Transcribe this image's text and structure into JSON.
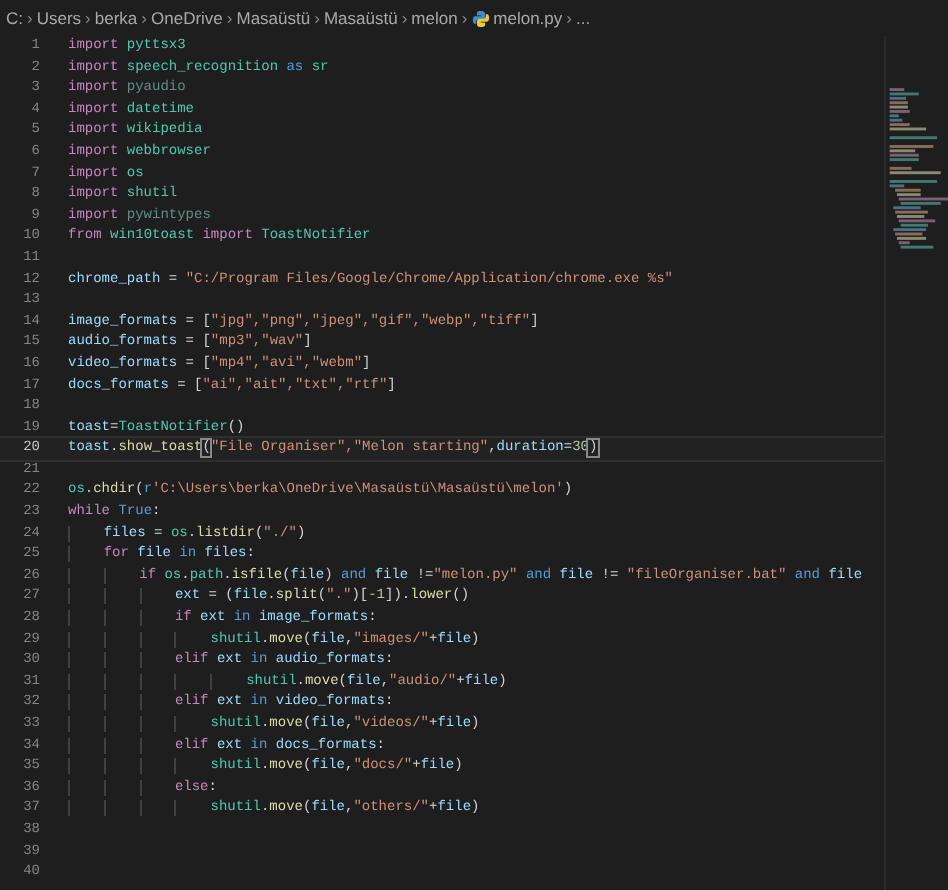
{
  "breadcrumb": [
    {
      "text": "C:",
      "kind": "folder"
    },
    {
      "separator": "›",
      "text": "Users",
      "kind": "folder"
    },
    {
      "separator": "›",
      "text": "berka",
      "kind": "folder"
    },
    {
      "separator": "›",
      "text": "OneDrive",
      "kind": "folder"
    },
    {
      "separator": "›",
      "text": "Masaüstü",
      "kind": "folder"
    },
    {
      "separator": "›",
      "text": "Masaüstü",
      "kind": "folder"
    },
    {
      "separator": "›",
      "text": "melon",
      "kind": "folder"
    },
    {
      "separator": "›",
      "text": "melon.py",
      "kind": "file"
    },
    {
      "separator": "›",
      "text": "...",
      "kind": "symbol"
    }
  ],
  "lines": [
    {
      "number": "1",
      "current": false,
      "tokens": [
        {
          "kind": "keyword",
          "text": "import "
        },
        {
          "kind": "module",
          "text": "pyttsx3"
        }
      ]
    },
    {
      "number": "2",
      "current": false,
      "tokens": [
        {
          "kind": "keyword",
          "text": "import "
        },
        {
          "kind": "module",
          "text": "speech_recognition "
        },
        {
          "kind": "constant",
          "text": "as "
        },
        {
          "kind": "module",
          "text": "sr"
        }
      ]
    },
    {
      "number": "3",
      "current": false,
      "tokens": [
        {
          "kind": "keyword",
          "text": "import "
        },
        {
          "kind": "unresolved",
          "text": "pyaudio"
        }
      ]
    },
    {
      "number": "4",
      "current": false,
      "tokens": [
        {
          "kind": "keyword",
          "text": "import "
        },
        {
          "kind": "module",
          "text": "datetime"
        }
      ]
    },
    {
      "number": "5",
      "current": false,
      "tokens": [
        {
          "kind": "keyword",
          "text": "import "
        },
        {
          "kind": "module",
          "text": "wikipedia"
        }
      ]
    },
    {
      "number": "6",
      "current": false,
      "tokens": [
        {
          "kind": "keyword",
          "text": "import "
        },
        {
          "kind": "module",
          "text": "webbrowser"
        }
      ]
    },
    {
      "number": "7",
      "current": false,
      "tokens": [
        {
          "kind": "keyword",
          "text": "import "
        },
        {
          "kind": "module",
          "text": "os"
        }
      ]
    },
    {
      "number": "8",
      "current": false,
      "tokens": [
        {
          "kind": "keyword",
          "text": "import "
        },
        {
          "kind": "module",
          "text": "shutil"
        }
      ]
    },
    {
      "number": "9",
      "current": false,
      "tokens": [
        {
          "kind": "keyword",
          "text": "import "
        },
        {
          "kind": "unresolved",
          "text": "pywintypes"
        }
      ]
    },
    {
      "number": "10",
      "current": false,
      "tokens": [
        {
          "kind": "keyword",
          "text": "from "
        },
        {
          "kind": "module",
          "text": "win10toast "
        },
        {
          "kind": "keyword",
          "text": "import "
        },
        {
          "kind": "module",
          "text": "ToastNotifier"
        }
      ]
    },
    {
      "number": "11",
      "current": false
    },
    {
      "number": "12",
      "current": false,
      "tokens": [
        {
          "kind": "variable",
          "text": "chrome_path"
        },
        {
          "kind": "plain",
          "text": " = "
        },
        {
          "kind": "string",
          "text": "\"C:/Program Files/Google/Chrome/Application/chrome.exe %s\""
        }
      ]
    },
    {
      "number": "13",
      "current": false
    },
    {
      "number": "14",
      "current": false,
      "tokens": [
        {
          "kind": "variable",
          "text": "image_formats"
        },
        {
          "kind": "plain",
          "text": " = ["
        },
        {
          "kind": "string",
          "text": "\"jpg\",\"png\",\"jpeg\",\"gif\",\"webp\",\"tiff\""
        },
        {
          "kind": "plain",
          "text": "]"
        }
      ]
    },
    {
      "number": "15",
      "current": false,
      "tokens": [
        {
          "kind": "variable",
          "text": "audio_formats"
        },
        {
          "kind": "plain",
          "text": " = ["
        },
        {
          "kind": "string",
          "text": "\"mp3\",\"wav\""
        },
        {
          "kind": "plain",
          "text": "]"
        }
      ]
    },
    {
      "number": "16",
      "current": false,
      "tokens": [
        {
          "kind": "variable",
          "text": "video_formats"
        },
        {
          "kind": "plain",
          "text": " = ["
        },
        {
          "kind": "string",
          "text": "\"mp4\",\"avi\",\"webm\""
        },
        {
          "kind": "plain",
          "text": "]"
        }
      ]
    },
    {
      "number": "17",
      "current": false,
      "tokens": [
        {
          "kind": "variable",
          "text": "docs_formats"
        },
        {
          "kind": "plain",
          "text": " = ["
        },
        {
          "kind": "string",
          "text": "\"ai\",\"ait\",\"txt\",\"rtf\""
        },
        {
          "kind": "plain",
          "text": "]"
        }
      ]
    },
    {
      "number": "18",
      "current": false
    },
    {
      "number": "19",
      "current": false,
      "tokens": [
        {
          "kind": "variable",
          "text": "toast"
        },
        {
          "kind": "plain",
          "text": "="
        },
        {
          "kind": "module",
          "text": "ToastNotifier"
        },
        {
          "kind": "plain",
          "text": "()"
        }
      ]
    },
    {
      "number": "20",
      "current": true,
      "tokens": [
        {
          "kind": "variable",
          "text": "toast"
        },
        {
          "kind": "plain",
          "text": "."
        },
        {
          "kind": "function",
          "text": "show_toast"
        },
        {
          "kind": "bracket_match",
          "text": "("
        },
        {
          "kind": "string",
          "text": "\"File Organiser\",\"Melon starting\""
        },
        {
          "kind": "plain",
          "text": ","
        },
        {
          "kind": "variable",
          "text": "duration"
        },
        {
          "kind": "plain",
          "text": "="
        },
        {
          "kind": "number",
          "text": "30"
        },
        {
          "kind": "bracket_match",
          "text": ")"
        }
      ]
    },
    {
      "number": "21",
      "current": false
    },
    {
      "number": "22",
      "current": false,
      "tokens": [
        {
          "kind": "module",
          "text": "os"
        },
        {
          "kind": "plain",
          "text": "."
        },
        {
          "kind": "function",
          "text": "chdir"
        },
        {
          "kind": "plain",
          "text": "("
        },
        {
          "kind": "constant",
          "text": "r"
        },
        {
          "kind": "string",
          "text": "'C:\\Users\\berka\\OneDrive\\Masaüstü\\Masaüstü\\melon'"
        },
        {
          "kind": "plain",
          "text": ")"
        }
      ]
    },
    {
      "number": "23",
      "current": false,
      "tokens": [
        {
          "kind": "keyword",
          "text": "while "
        },
        {
          "kind": "constant",
          "text": "True"
        },
        {
          "kind": "plain",
          "text": ":"
        }
      ]
    },
    {
      "number": "24",
      "current": false,
      "tokens": [
        {
          "kind": "variable",
          "text": "    files"
        },
        {
          "kind": "plain",
          "text": " = "
        },
        {
          "kind": "module",
          "text": "os"
        },
        {
          "kind": "plain",
          "text": "."
        },
        {
          "kind": "function",
          "text": "listdir"
        },
        {
          "kind": "plain",
          "text": "("
        },
        {
          "kind": "string",
          "text": "\"./\""
        },
        {
          "kind": "plain",
          "text": ")"
        }
      ]
    },
    {
      "number": "25",
      "current": false,
      "tokens": [
        {
          "kind": "keyword",
          "text": "    for "
        },
        {
          "kind": "variable",
          "text": "file "
        },
        {
          "kind": "constant",
          "text": "in "
        },
        {
          "kind": "variable",
          "text": "files"
        },
        {
          "kind": "plain",
          "text": ":"
        }
      ]
    },
    {
      "number": "26",
      "current": false,
      "tokens": [
        {
          "kind": "keyword",
          "text": "        if "
        },
        {
          "kind": "module",
          "text": "os"
        },
        {
          "kind": "plain",
          "text": "."
        },
        {
          "kind": "module",
          "text": "path"
        },
        {
          "kind": "plain",
          "text": "."
        },
        {
          "kind": "function",
          "text": "isfile"
        },
        {
          "kind": "plain",
          "text": "("
        },
        {
          "kind": "variable",
          "text": "file"
        },
        {
          "kind": "plain",
          "text": ") "
        },
        {
          "kind": "constant",
          "text": "and "
        },
        {
          "kind": "variable",
          "text": "file"
        },
        {
          "kind": "plain",
          "text": " !="
        },
        {
          "kind": "string",
          "text": "\"melon.py\" "
        },
        {
          "kind": "constant",
          "text": "and "
        },
        {
          "kind": "variable",
          "text": "file"
        },
        {
          "kind": "plain",
          "text": " != "
        },
        {
          "kind": "string",
          "text": "\"fileOrganiser.bat\" "
        },
        {
          "kind": "constant",
          "text": "and "
        },
        {
          "kind": "variable",
          "text": "file"
        }
      ]
    },
    {
      "number": "27",
      "current": false,
      "tokens": [
        {
          "kind": "variable",
          "text": "            ext"
        },
        {
          "kind": "plain",
          "text": " = ("
        },
        {
          "kind": "variable",
          "text": "file"
        },
        {
          "kind": "plain",
          "text": "."
        },
        {
          "kind": "function",
          "text": "split"
        },
        {
          "kind": "plain",
          "text": "("
        },
        {
          "kind": "string",
          "text": "\".\""
        },
        {
          "kind": "plain",
          "text": ")["
        },
        {
          "kind": "number",
          "text": "-1"
        },
        {
          "kind": "plain",
          "text": "])."
        },
        {
          "kind": "function",
          "text": "lower"
        },
        {
          "kind": "plain",
          "text": "()"
        }
      ]
    },
    {
      "number": "28",
      "current": false,
      "tokens": [
        {
          "kind": "keyword",
          "text": "            if "
        },
        {
          "kind": "variable",
          "text": "ext "
        },
        {
          "kind": "constant",
          "text": "in "
        },
        {
          "kind": "variable",
          "text": "image_formats"
        },
        {
          "kind": "plain",
          "text": ":"
        }
      ]
    },
    {
      "number": "29",
      "current": false,
      "tokens": [
        {
          "kind": "module",
          "text": "                shutil"
        },
        {
          "kind": "plain",
          "text": "."
        },
        {
          "kind": "function",
          "text": "move"
        },
        {
          "kind": "plain",
          "text": "("
        },
        {
          "kind": "variable",
          "text": "file"
        },
        {
          "kind": "plain",
          "text": ","
        },
        {
          "kind": "string",
          "text": "\"images/\""
        },
        {
          "kind": "plain",
          "text": "+"
        },
        {
          "kind": "variable",
          "text": "file"
        },
        {
          "kind": "plain",
          "text": ")"
        }
      ]
    },
    {
      "number": "30",
      "current": false,
      "tokens": [
        {
          "kind": "keyword",
          "text": "            elif "
        },
        {
          "kind": "variable",
          "text": "ext "
        },
        {
          "kind": "constant",
          "text": "in "
        },
        {
          "kind": "variable",
          "text": "audio_formats"
        },
        {
          "kind": "plain",
          "text": ":"
        }
      ]
    },
    {
      "number": "31",
      "current": false,
      "tokens": [
        {
          "kind": "module",
          "text": "                    shutil"
        },
        {
          "kind": "plain",
          "text": "."
        },
        {
          "kind": "function",
          "text": "move"
        },
        {
          "kind": "plain",
          "text": "("
        },
        {
          "kind": "variable",
          "text": "file"
        },
        {
          "kind": "plain",
          "text": ","
        },
        {
          "kind": "string",
          "text": "\"audio/\""
        },
        {
          "kind": "plain",
          "text": "+"
        },
        {
          "kind": "variable",
          "text": "file"
        },
        {
          "kind": "plain",
          "text": ")"
        }
      ]
    },
    {
      "number": "32",
      "current": false,
      "tokens": [
        {
          "kind": "keyword",
          "text": "            elif "
        },
        {
          "kind": "variable",
          "text": "ext "
        },
        {
          "kind": "constant",
          "text": "in "
        },
        {
          "kind": "variable",
          "text": "video_formats"
        },
        {
          "kind": "plain",
          "text": ":"
        }
      ]
    },
    {
      "number": "33",
      "current": false,
      "tokens": [
        {
          "kind": "module",
          "text": "                shutil"
        },
        {
          "kind": "plain",
          "text": "."
        },
        {
          "kind": "function",
          "text": "move"
        },
        {
          "kind": "plain",
          "text": "("
        },
        {
          "kind": "variable",
          "text": "file"
        },
        {
          "kind": "plain",
          "text": ","
        },
        {
          "kind": "string",
          "text": "\"videos/\""
        },
        {
          "kind": "plain",
          "text": "+"
        },
        {
          "kind": "variable",
          "text": "file"
        },
        {
          "kind": "plain",
          "text": ")"
        }
      ]
    },
    {
      "number": "34",
      "current": false,
      "tokens": [
        {
          "kind": "keyword",
          "text": "            elif "
        },
        {
          "kind": "variable",
          "text": "ext "
        },
        {
          "kind": "constant",
          "text": "in "
        },
        {
          "kind": "variable",
          "text": "docs_formats"
        },
        {
          "kind": "plain",
          "text": ":"
        }
      ]
    },
    {
      "number": "35",
      "current": false,
      "tokens": [
        {
          "kind": "module",
          "text": "                shutil"
        },
        {
          "kind": "plain",
          "text": "."
        },
        {
          "kind": "function",
          "text": "move"
        },
        {
          "kind": "plain",
          "text": "("
        },
        {
          "kind": "variable",
          "text": "file"
        },
        {
          "kind": "plain",
          "text": ","
        },
        {
          "kind": "string",
          "text": "\"docs/\""
        },
        {
          "kind": "plain",
          "text": "+"
        },
        {
          "kind": "variable",
          "text": "file"
        },
        {
          "kind": "plain",
          "text": ")"
        }
      ]
    },
    {
      "number": "36",
      "current": false,
      "tokens": [
        {
          "kind": "keyword",
          "text": "            else"
        },
        {
          "kind": "plain",
          "text": ":"
        }
      ]
    },
    {
      "number": "37",
      "current": false,
      "tokens": [
        {
          "kind": "module",
          "text": "                shutil"
        },
        {
          "kind": "plain",
          "text": "."
        },
        {
          "kind": "function",
          "text": "move"
        },
        {
          "kind": "plain",
          "text": "("
        },
        {
          "kind": "variable",
          "text": "file"
        },
        {
          "kind": "plain",
          "text": ","
        },
        {
          "kind": "string",
          "text": "\"others/\""
        },
        {
          "kind": "plain",
          "text": "+"
        },
        {
          "kind": "variable",
          "text": "file"
        },
        {
          "kind": "plain",
          "text": ")"
        }
      ]
    },
    {
      "number": "38",
      "current": false
    },
    {
      "number": "39",
      "current": false
    },
    {
      "number": "40",
      "current": false
    }
  ]
}
